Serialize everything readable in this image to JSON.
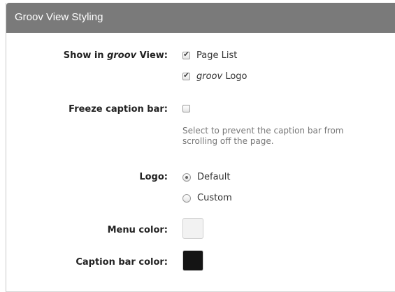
{
  "header": {
    "title": "Groov View Styling"
  },
  "show_in_view": {
    "label_prefix": "Show in ",
    "label_em": "groov",
    "label_suffix": " View:",
    "options": [
      {
        "label": "Page List",
        "checked": true
      },
      {
        "label_em": "groov",
        "label_suffix": " Logo",
        "checked": true
      }
    ]
  },
  "freeze_caption": {
    "label": "Freeze caption bar:",
    "checked": false,
    "help": "Select to prevent the caption bar from scrolling off the page."
  },
  "logo": {
    "label": "Logo:",
    "options": [
      {
        "label": "Default",
        "selected": true
      },
      {
        "label": "Custom",
        "selected": false
      }
    ]
  },
  "menu_color": {
    "label": "Menu color:",
    "value": "#f2f2f2"
  },
  "caption_bar_color": {
    "label": "Caption bar color:",
    "value": "#141414"
  }
}
